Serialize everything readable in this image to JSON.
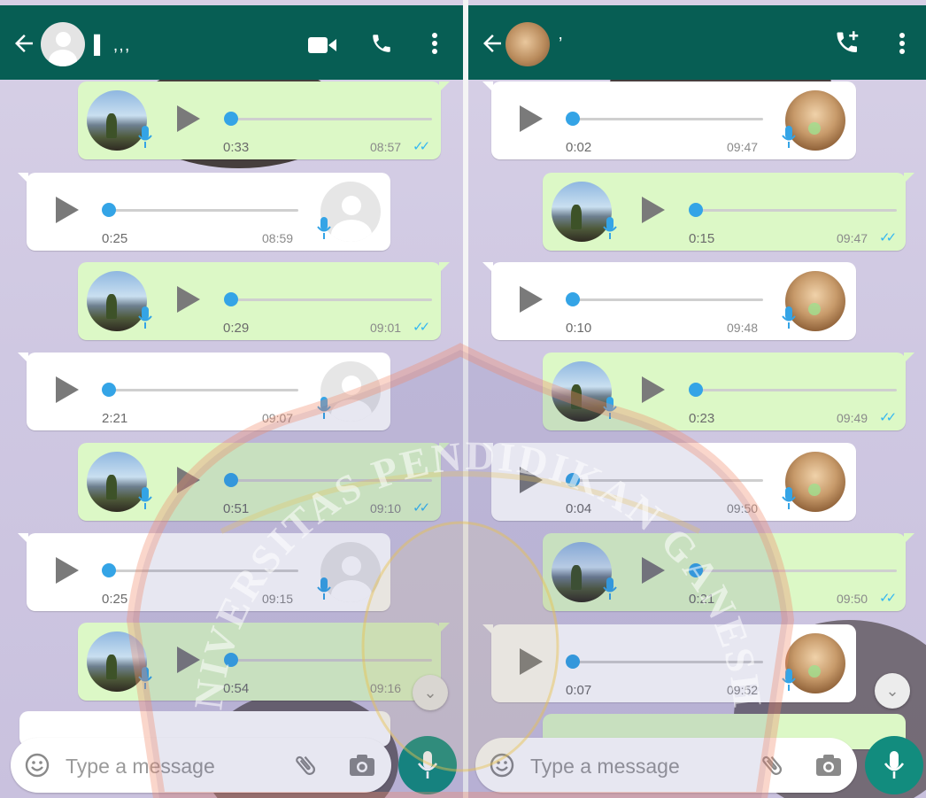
{
  "app": "WhatsApp",
  "colors": {
    "header": "#075e54",
    "outgoing_bubble": "#dcf8c6",
    "incoming_bubble": "#ffffff",
    "progress_knob": "#34a4e6",
    "read_ticks": "#34b7f1",
    "mic_fab": "#128c7e"
  },
  "left": {
    "header": {
      "back_icon": "arrow-left-icon",
      "contact_name": "▌ ,,,",
      "icons": [
        "video-call-icon",
        "voice-call-icon",
        "more-vert-icon"
      ]
    },
    "messages": [
      {
        "dir": "out",
        "duration": "0:33",
        "time": "08:57",
        "status": "read"
      },
      {
        "dir": "in",
        "duration": "0:25",
        "time": "08:59"
      },
      {
        "dir": "out",
        "duration": "0:29",
        "time": "09:01",
        "status": "read"
      },
      {
        "dir": "in",
        "duration": "2:21",
        "time": "09:07"
      },
      {
        "dir": "out",
        "duration": "0:51",
        "time": "09:10",
        "status": "read"
      },
      {
        "dir": "in",
        "duration": "0:25",
        "time": "09:15"
      },
      {
        "dir": "out",
        "duration": "0:54",
        "time": "09:16",
        "status": "read"
      }
    ],
    "input": {
      "placeholder": "Type a message"
    }
  },
  "right": {
    "header": {
      "back_icon": "arrow-left-icon",
      "contact_name": "ʼ",
      "icons": [
        "add-call-icon",
        "more-vert-icon"
      ]
    },
    "messages": [
      {
        "dir": "in",
        "duration": "0:02",
        "time": "09:47"
      },
      {
        "dir": "out",
        "duration": "0:15",
        "time": "09:47",
        "status": "read"
      },
      {
        "dir": "in",
        "duration": "0:10",
        "time": "09:48"
      },
      {
        "dir": "out",
        "duration": "0:23",
        "time": "09:49",
        "status": "read"
      },
      {
        "dir": "in",
        "duration": "0:04",
        "time": "09:50"
      },
      {
        "dir": "out",
        "duration": "0:21",
        "time": "09:50",
        "status": "read"
      },
      {
        "dir": "in",
        "duration": "0:07",
        "time": "09:52"
      }
    ],
    "input": {
      "placeholder": "Type a message"
    }
  },
  "read_ticks_glyph": "✓✓",
  "scroll_down_glyph": "⌄",
  "watermark": {
    "text": "UNIVERSITAS PENDIDIKAN GANESHA"
  }
}
